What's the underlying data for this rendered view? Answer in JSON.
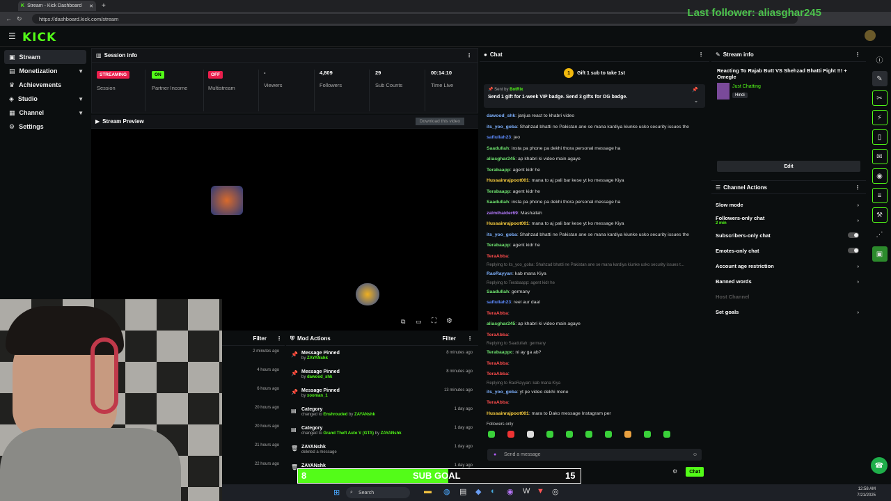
{
  "browser": {
    "tab_title": "Stream - Kick Dashboard",
    "url": "https://dashboard.kick.com/stream"
  },
  "overlay": {
    "last_follower": "Last follower: aliasghar245"
  },
  "app": {
    "logo": "KICK"
  },
  "sidebar": {
    "items": [
      {
        "label": "Stream",
        "icon": "stream-icon"
      },
      {
        "label": "Monetization",
        "icon": "monetization-icon"
      },
      {
        "label": "Achievements",
        "icon": "trophy-icon"
      },
      {
        "label": "Studio",
        "icon": "studio-icon"
      },
      {
        "label": "Channel",
        "icon": "channel-icon"
      },
      {
        "label": "Settings",
        "icon": "gear-icon"
      }
    ]
  },
  "session": {
    "title": "Session info",
    "stats": [
      {
        "value": "STREAMING",
        "label": "Session"
      },
      {
        "value": "ON",
        "label": "Partner Income"
      },
      {
        "value": "OFF",
        "label": "Multistream"
      },
      {
        "value": "-",
        "label": "Viewers"
      },
      {
        "value": "4,809",
        "label": "Followers"
      },
      {
        "value": "29",
        "label": "Sub Counts"
      },
      {
        "value": "00:14:10",
        "label": "Time Live"
      }
    ]
  },
  "preview": {
    "title": "Stream Preview",
    "download": "Download this video"
  },
  "modactions": {
    "title": "Mod Actions",
    "filter": "Filter",
    "rows": [
      {
        "title": "Message Pinned",
        "by": "by ",
        "user": "ZAYANshk",
        "time": "8 minutes ago"
      },
      {
        "title": "Message Pinned",
        "by": "by ",
        "user": "dawood_shk",
        "time": "8 minutes ago"
      },
      {
        "title": "Message Pinned",
        "by": "by ",
        "user": "xooman_1",
        "time": "13 minutes ago"
      },
      {
        "title": "Category",
        "by": "changed to ",
        "user": "Enshrouded",
        "by2": " by ",
        "user2": "ZAYANshk",
        "time": "1 day ago"
      },
      {
        "title": "Category",
        "by": "changed to ",
        "user": "Grand Theft Auto V (GTA)",
        "by2": " by ",
        "user2": "ZAYANshk",
        "time": "1 day ago"
      },
      {
        "title": "ZAYANshk",
        "by": "deleted a message",
        "user": "",
        "time": "1 day ago"
      },
      {
        "title": "ZAYANshk",
        "by": "",
        "user": "",
        "time": "1 day ago"
      }
    ]
  },
  "leftlog": {
    "filter": "Filter",
    "times": [
      "2 minutes ago",
      "4 hours ago",
      "6 hours ago",
      "20 hours ago",
      "20 hours ago",
      "21 hours ago",
      "22 hours ago"
    ]
  },
  "chat": {
    "title": "Chat",
    "gift_banner": "Gift 1 sub to take 1st",
    "pinned_sender": "Sent by",
    "pinned_user": "BotRix",
    "pinned_text": "Send 1 gift for 1-week VIP badge. Send 3 gifts for OG badge.",
    "messages": [
      {
        "user": "dawood_shk",
        "color": "#7fb2ff",
        "text": ": janjua react to khabri video"
      },
      {
        "user": "its_yoo_goba",
        "color": "#7fb2ff",
        "text": ": Shahzad bhatti ne Pakistan ane se mana kardiya kiunke usko security issues the"
      },
      {
        "user": "safiullah23",
        "color": "#5e8cff",
        "text": ": jeo"
      },
      {
        "user": "Saadullah",
        "color": "#6fe36f",
        "text": ": insta pa phone pa dekhi thora personal message ha"
      },
      {
        "user": "aliasghar245",
        "color": "#6fe36f",
        "text": ": ap khabri ki video main agaye"
      },
      {
        "user": "Terabaapp",
        "color": "#6fe36f",
        "text": ": agent kidr he"
      },
      {
        "user": "Hussainrajpoot001",
        "color": "#ffd23f",
        "text": ": mana to aj pali bar kese yt ko message Kiya"
      },
      {
        "user": "Terabaapp",
        "color": "#6fe36f",
        "text": ": agent kidr he"
      },
      {
        "user": "Saadullah",
        "color": "#6fe36f",
        "text": ": insta pa phone pa dekhi thora personal message ha"
      },
      {
        "user": "zalmihaider69",
        "color": "#b67bff",
        "text": ": Mashallah"
      },
      {
        "user": "Hussainrajpoot001",
        "color": "#ffd23f",
        "text": ": mana to aj pali bar kese yt ko message Kiya"
      },
      {
        "user": "its_yoo_goba",
        "color": "#7fb2ff",
        "text": ": Shahzad bhatti ne Pakistan ane se mana kardiya kiunke usko security issues the"
      },
      {
        "user": "Terabaapp",
        "color": "#6fe36f",
        "text": ": agent kidr he"
      },
      {
        "user": "TeraAbba",
        "color": "#ff4d4d",
        "text": ":"
      },
      {
        "reply": "Replying to its_yoo_goba: Shahzad bhatti ne Pakistan ane se mana kardiya kiunke usko security issues t..."
      },
      {
        "user": "RaoRayyan",
        "color": "#7fb2ff",
        "text": ": kab mana Kiya"
      },
      {
        "reply": "Replying to Terabaapp: agent kidr he"
      },
      {
        "user": "Saadullah",
        "color": "#6fe36f",
        "text": ": germany"
      },
      {
        "user": "safiullah23",
        "color": "#5e8cff",
        "text": ": reel aur daal"
      },
      {
        "user": "TeraAbba",
        "color": "#ff4d4d",
        "text": ":"
      },
      {
        "user": "aliasghar245",
        "color": "#6fe36f",
        "text": ": ap khabri ki video main agaye"
      },
      {
        "user": "TeraAbba",
        "color": "#ff4d4d",
        "text": ":"
      },
      {
        "reply": "Replying to Saadullah: germany"
      },
      {
        "user": "Terabaappc",
        "color": "#6fe36f",
        "text": ": ni ay ga ab?"
      },
      {
        "user": "TeraAbba",
        "color": "#ff4d4d",
        "text": ":"
      },
      {
        "user": "TeraAbba",
        "color": "#ff4d4d",
        "text": ":"
      },
      {
        "reply": "Replying to RaoRayyan: kab mana Kiya"
      },
      {
        "user": "its_yoo_goba",
        "color": "#7fb2ff",
        "text": ": yt pe video dekhi mene"
      },
      {
        "user": "TeraAbba",
        "color": "#ff4d4d",
        "text": ":"
      },
      {
        "user": "Hussainrajpoot001",
        "color": "#ffd23f",
        "text": ": mara to Dako message Instagram per"
      }
    ],
    "followers_only": "Followers only",
    "input_placeholder": "Send a message",
    "send_label": "Chat"
  },
  "streaminfo": {
    "title": "Stream info",
    "stream_title": "Reacting To Rajab Butt VS Shehzad Bhatti Fight !!! + Omegle",
    "category": "Just Chatting",
    "tag": "Hindi",
    "edit": "Edit"
  },
  "channelactions": {
    "title": "Channel Actions",
    "items": [
      {
        "label": "Slow mode",
        "sub": "",
        "type": "arrow"
      },
      {
        "label": "Followers-only chat",
        "sub": "2 min",
        "type": "arrow"
      },
      {
        "label": "Subscribers-only chat",
        "sub": "",
        "type": "toggle"
      },
      {
        "label": "Emotes-only chat",
        "sub": "",
        "type": "toggle"
      },
      {
        "label": "Account age restriction",
        "sub": "",
        "type": "arrow"
      },
      {
        "label": "Banned words",
        "sub": "",
        "type": "arrow"
      },
      {
        "label": "Host Channel",
        "sub": "",
        "type": "disabled"
      },
      {
        "label": "Set goals",
        "sub": "",
        "type": "arrow"
      }
    ]
  },
  "subgoal": {
    "current": "8",
    "label": "SUB GOAL",
    "target": "15",
    "progress": 0.533
  },
  "taskbar": {
    "search": "Search",
    "time": "12:58 AM",
    "date": "7/21/2025"
  },
  "colors": {
    "accent": "#53fc18",
    "streaming": "#e91e4c",
    "panel": "#121417"
  }
}
